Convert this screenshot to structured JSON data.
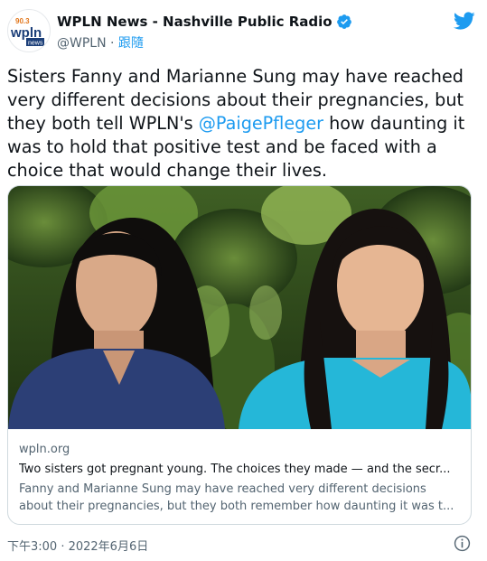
{
  "account": {
    "display_name": "WPLN News - Nashville Public Radio",
    "handle": "@WPLN",
    "separator": "·",
    "follow_label": "跟隨",
    "avatar_text": {
      "top": "90.3",
      "main": "wpln",
      "sub": "news"
    },
    "verified": true
  },
  "tweet": {
    "text_before": "Sisters Fanny and Marianne Sung may have reached very different decisions about their pregnancies, but  they both tell WPLN's ",
    "mention": "@PaigePfleger",
    "text_after": " how daunting it was to hold that positive test and be faced with a choice that would change their lives."
  },
  "card": {
    "domain": "wpln.org",
    "title": "Two sisters got pregnant young. The choices they made — and the secr...",
    "description": "Fanny and Marianne Sung may have reached very different decisions about their pregnancies, but they both remember how daunting it was t..."
  },
  "footer": {
    "timestamp": "下午3:00 · 2022年6月6日"
  },
  "colors": {
    "accent": "#1d9bf0",
    "text_primary": "#0f1419",
    "text_secondary": "#536471",
    "border": "#cfd9de"
  },
  "icons": [
    "twitter-bird-icon",
    "verified-badge-icon",
    "info-icon"
  ]
}
